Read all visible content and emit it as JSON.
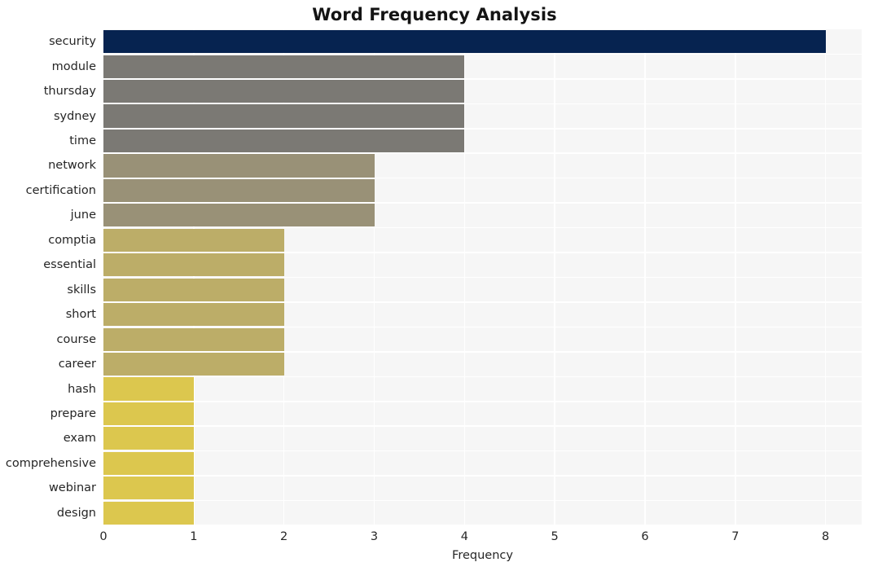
{
  "chart_data": {
    "type": "bar",
    "orientation": "horizontal",
    "title": "Word Frequency Analysis",
    "xlabel": "Frequency",
    "ylabel": "",
    "xlim": [
      0,
      8.4
    ],
    "xticks": [
      0,
      1,
      2,
      3,
      4,
      5,
      6,
      7,
      8
    ],
    "xtick_labels": [
      "0",
      "1",
      "2",
      "3",
      "4",
      "5",
      "6",
      "7",
      "8"
    ],
    "grid": "vertical-and-horizontal-white-on-gray",
    "legend": "none",
    "categories": [
      "security",
      "module",
      "thursday",
      "sydney",
      "time",
      "network",
      "certification",
      "june",
      "comptia",
      "essential",
      "skills",
      "short",
      "course",
      "career",
      "hash",
      "prepare",
      "exam",
      "comprehensive",
      "webinar",
      "design"
    ],
    "values": [
      8,
      4,
      4,
      4,
      4,
      3,
      3,
      3,
      2,
      2,
      2,
      2,
      2,
      2,
      1,
      1,
      1,
      1,
      1,
      1
    ],
    "bar_colors": [
      "#062350",
      "#7b7974",
      "#7b7974",
      "#7b7974",
      "#7b7974",
      "#999177",
      "#999177",
      "#999177",
      "#bcad68",
      "#bcad68",
      "#bcad68",
      "#bcad68",
      "#bcad68",
      "#bcad68",
      "#dcc74e",
      "#dcc74e",
      "#dcc74e",
      "#dcc74e",
      "#dcc74e",
      "#dcc74e"
    ]
  },
  "style": {
    "plot_background": "#f6f6f6",
    "grid_color": "#ffffff",
    "page_background": "#ffffff",
    "text_color": "#262626",
    "title_color": "#141414"
  }
}
